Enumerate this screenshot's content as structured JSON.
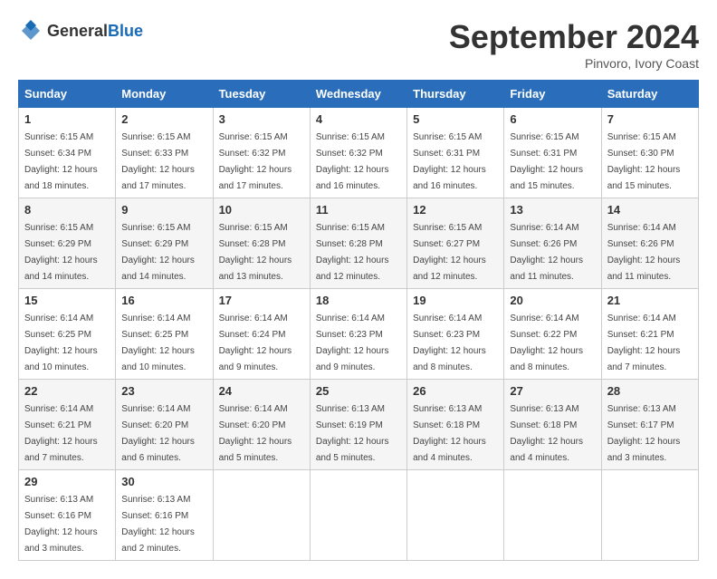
{
  "logo": {
    "general": "General",
    "blue": "Blue"
  },
  "title": "September 2024",
  "location": "Pinvoro, Ivory Coast",
  "weekdays": [
    "Sunday",
    "Monday",
    "Tuesday",
    "Wednesday",
    "Thursday",
    "Friday",
    "Saturday"
  ],
  "weeks": [
    [
      {
        "day": "1",
        "sunrise": "6:15 AM",
        "sunset": "6:34 PM",
        "daylight": "12 hours and 18 minutes."
      },
      {
        "day": "2",
        "sunrise": "6:15 AM",
        "sunset": "6:33 PM",
        "daylight": "12 hours and 17 minutes."
      },
      {
        "day": "3",
        "sunrise": "6:15 AM",
        "sunset": "6:32 PM",
        "daylight": "12 hours and 17 minutes."
      },
      {
        "day": "4",
        "sunrise": "6:15 AM",
        "sunset": "6:32 PM",
        "daylight": "12 hours and 16 minutes."
      },
      {
        "day": "5",
        "sunrise": "6:15 AM",
        "sunset": "6:31 PM",
        "daylight": "12 hours and 16 minutes."
      },
      {
        "day": "6",
        "sunrise": "6:15 AM",
        "sunset": "6:31 PM",
        "daylight": "12 hours and 15 minutes."
      },
      {
        "day": "7",
        "sunrise": "6:15 AM",
        "sunset": "6:30 PM",
        "daylight": "12 hours and 15 minutes."
      }
    ],
    [
      {
        "day": "8",
        "sunrise": "6:15 AM",
        "sunset": "6:29 PM",
        "daylight": "12 hours and 14 minutes."
      },
      {
        "day": "9",
        "sunrise": "6:15 AM",
        "sunset": "6:29 PM",
        "daylight": "12 hours and 14 minutes."
      },
      {
        "day": "10",
        "sunrise": "6:15 AM",
        "sunset": "6:28 PM",
        "daylight": "12 hours and 13 minutes."
      },
      {
        "day": "11",
        "sunrise": "6:15 AM",
        "sunset": "6:28 PM",
        "daylight": "12 hours and 12 minutes."
      },
      {
        "day": "12",
        "sunrise": "6:15 AM",
        "sunset": "6:27 PM",
        "daylight": "12 hours and 12 minutes."
      },
      {
        "day": "13",
        "sunrise": "6:14 AM",
        "sunset": "6:26 PM",
        "daylight": "12 hours and 11 minutes."
      },
      {
        "day": "14",
        "sunrise": "6:14 AM",
        "sunset": "6:26 PM",
        "daylight": "12 hours and 11 minutes."
      }
    ],
    [
      {
        "day": "15",
        "sunrise": "6:14 AM",
        "sunset": "6:25 PM",
        "daylight": "12 hours and 10 minutes."
      },
      {
        "day": "16",
        "sunrise": "6:14 AM",
        "sunset": "6:25 PM",
        "daylight": "12 hours and 10 minutes."
      },
      {
        "day": "17",
        "sunrise": "6:14 AM",
        "sunset": "6:24 PM",
        "daylight": "12 hours and 9 minutes."
      },
      {
        "day": "18",
        "sunrise": "6:14 AM",
        "sunset": "6:23 PM",
        "daylight": "12 hours and 9 minutes."
      },
      {
        "day": "19",
        "sunrise": "6:14 AM",
        "sunset": "6:23 PM",
        "daylight": "12 hours and 8 minutes."
      },
      {
        "day": "20",
        "sunrise": "6:14 AM",
        "sunset": "6:22 PM",
        "daylight": "12 hours and 8 minutes."
      },
      {
        "day": "21",
        "sunrise": "6:14 AM",
        "sunset": "6:21 PM",
        "daylight": "12 hours and 7 minutes."
      }
    ],
    [
      {
        "day": "22",
        "sunrise": "6:14 AM",
        "sunset": "6:21 PM",
        "daylight": "12 hours and 7 minutes."
      },
      {
        "day": "23",
        "sunrise": "6:14 AM",
        "sunset": "6:20 PM",
        "daylight": "12 hours and 6 minutes."
      },
      {
        "day": "24",
        "sunrise": "6:14 AM",
        "sunset": "6:20 PM",
        "daylight": "12 hours and 5 minutes."
      },
      {
        "day": "25",
        "sunrise": "6:13 AM",
        "sunset": "6:19 PM",
        "daylight": "12 hours and 5 minutes."
      },
      {
        "day": "26",
        "sunrise": "6:13 AM",
        "sunset": "6:18 PM",
        "daylight": "12 hours and 4 minutes."
      },
      {
        "day": "27",
        "sunrise": "6:13 AM",
        "sunset": "6:18 PM",
        "daylight": "12 hours and 4 minutes."
      },
      {
        "day": "28",
        "sunrise": "6:13 AM",
        "sunset": "6:17 PM",
        "daylight": "12 hours and 3 minutes."
      }
    ],
    [
      {
        "day": "29",
        "sunrise": "6:13 AM",
        "sunset": "6:16 PM",
        "daylight": "12 hours and 3 minutes."
      },
      {
        "day": "30",
        "sunrise": "6:13 AM",
        "sunset": "6:16 PM",
        "daylight": "12 hours and 2 minutes."
      },
      null,
      null,
      null,
      null,
      null
    ]
  ],
  "labels": {
    "sunrise": "Sunrise:",
    "sunset": "Sunset:",
    "daylight": "Daylight:"
  }
}
